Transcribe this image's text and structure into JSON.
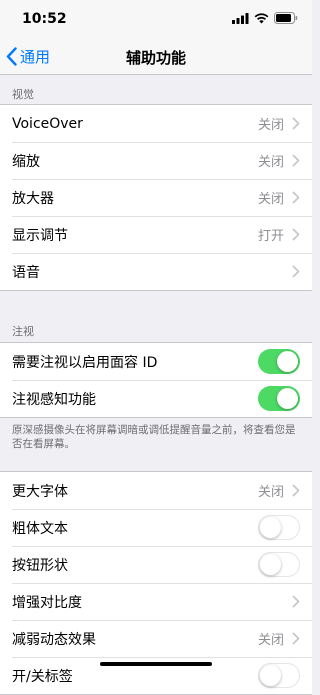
{
  "status": {
    "time": "10:52"
  },
  "nav": {
    "back_label": "通用",
    "title": "辅助功能"
  },
  "vision": {
    "header": "视觉",
    "items": [
      {
        "label": "VoiceOver",
        "value": "关闭"
      },
      {
        "label": "缩放",
        "value": "关闭"
      },
      {
        "label": "放大器",
        "value": "关闭"
      },
      {
        "label": "显示调节",
        "value": "打开"
      },
      {
        "label": "语音",
        "value": ""
      }
    ]
  },
  "attention": {
    "header": "注视",
    "items": [
      {
        "label": "需要注视以启用面容 ID",
        "on": true
      },
      {
        "label": "注视感知功能",
        "on": true
      }
    ],
    "footer": "原深感摄像头在将屏幕调暗或调低提醒音量之前，将查看您是否在看屏幕。"
  },
  "text": {
    "items": [
      {
        "label": "更大字体",
        "value": "关闭"
      },
      {
        "label": "粗体文本",
        "on": false
      },
      {
        "label": "按钮形状",
        "on": false
      },
      {
        "label": "增强对比度",
        "value": ""
      },
      {
        "label": "减弱动态效果",
        "value": "关闭"
      },
      {
        "label": "开/关标签",
        "on": false
      }
    ]
  },
  "colors": {
    "accent": "#007aff",
    "toggle_on": "#4cd964",
    "background": "#efeff4"
  }
}
